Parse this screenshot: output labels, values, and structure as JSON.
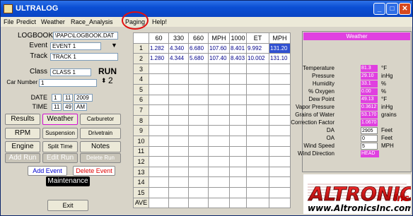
{
  "window": {
    "title": "ULTRALOG"
  },
  "menu": [
    "File",
    "Predict",
    "Weather",
    "Race_Analysis",
    "Paging",
    "Help!"
  ],
  "left": {
    "logbook_label": "LOGBOOK",
    "logbook_value": "\\PAPC\\LOGBOOK.DAT",
    "event_label": "Event",
    "event_value": "EVENT 1",
    "track_label": "Track",
    "track_value": "TRACK 1",
    "class_label": "Class",
    "class_value": "CLASS 1",
    "run_label": "RUN",
    "run_value": "2",
    "car_number_label": "Car Number",
    "car_number_value": "1",
    "date_label": "DATE",
    "date_m": "1",
    "date_d": "11",
    "date_y": "2009",
    "time_label": "TIME",
    "time_h": "11",
    "time_m": "49",
    "time_ampm": "AM",
    "buttons": {
      "results": "Results",
      "weather": "Weather",
      "carburetor": "Carburetor",
      "rpm": "RPM",
      "suspension": "Suspension",
      "drivetrain": "Drivetrain",
      "engine": "Engine",
      "split_time": "Split Time",
      "notes": "Notes",
      "add_run": "Add Run",
      "edit_run": "Edit Run",
      "delete_run": "Delete Run",
      "add_event": "Add Event",
      "delete_event": "Delete Event",
      "maintenance": "Maintenance",
      "exit": "Exit"
    }
  },
  "grid": {
    "headers": [
      "60",
      "330",
      "660",
      "MPH",
      "1000",
      "ET",
      "MPH"
    ],
    "rows": [
      {
        "n": "1",
        "cells": [
          "1.282",
          "4.340",
          "6.680",
          "107.60",
          "8.401",
          "9.992",
          "131.20"
        ]
      },
      {
        "n": "2",
        "cells": [
          "1.280",
          "4.344",
          "5.680",
          "107.40",
          "8.403",
          "10.002",
          "131.10"
        ]
      },
      {
        "n": "3",
        "cells": [
          "",
          "",
          "",
          "",
          "",
          "",
          ""
        ]
      },
      {
        "n": "4",
        "cells": [
          "",
          "",
          "",
          "",
          "",
          "",
          ""
        ]
      },
      {
        "n": "5",
        "cells": [
          "",
          "",
          "",
          "",
          "",
          "",
          ""
        ]
      },
      {
        "n": "6",
        "cells": [
          "",
          "",
          "",
          "",
          "",
          "",
          ""
        ]
      },
      {
        "n": "7",
        "cells": [
          "",
          "",
          "",
          "",
          "",
          "",
          ""
        ]
      },
      {
        "n": "8",
        "cells": [
          "",
          "",
          "",
          "",
          "",
          "",
          ""
        ]
      },
      {
        "n": "9",
        "cells": [
          "",
          "",
          "",
          "",
          "",
          "",
          ""
        ]
      },
      {
        "n": "10",
        "cells": [
          "",
          "",
          "",
          "",
          "",
          "",
          ""
        ]
      },
      {
        "n": "11",
        "cells": [
          "",
          "",
          "",
          "",
          "",
          "",
          ""
        ]
      },
      {
        "n": "12",
        "cells": [
          "",
          "",
          "",
          "",
          "",
          "",
          ""
        ]
      },
      {
        "n": "13",
        "cells": [
          "",
          "",
          "",
          "",
          "",
          "",
          ""
        ]
      },
      {
        "n": "14",
        "cells": [
          "",
          "",
          "",
          "",
          "",
          "",
          ""
        ]
      },
      {
        "n": "15",
        "cells": [
          "",
          "",
          "",
          "",
          "",
          "",
          ""
        ]
      },
      {
        "n": "AVE",
        "cells": [
          "",
          "",
          "",
          "",
          "",
          "",
          ""
        ]
      }
    ]
  },
  "weather": {
    "title": "Weather",
    "rows": [
      {
        "label": "Temperature",
        "value": "81.3",
        "unit": "°F"
      },
      {
        "label": "Pressure",
        "value": "29.10",
        "unit": "inHg"
      },
      {
        "label": "Humidity",
        "value": "33.1",
        "unit": "%"
      },
      {
        "label": "% Oxygen",
        "value": "0.00",
        "unit": "%"
      },
      {
        "label": "Dew Point",
        "value": "49.13",
        "unit": "°F"
      },
      {
        "label": "Vapor Pressure",
        "value": "0.3612",
        "unit": "inHg"
      },
      {
        "label": "Grains of Water",
        "value": "53.170",
        "unit": "grains"
      },
      {
        "label": "Correction Factor",
        "value": "1.0670",
        "unit": ""
      },
      {
        "label": "DA",
        "value": "2905",
        "unit": "Feet"
      },
      {
        "label": "OA",
        "value": "0",
        "unit": "Feet"
      },
      {
        "label": "Wind Speed",
        "value": "5",
        "unit": "MPH"
      },
      {
        "label": "Wind Direction",
        "value": "HEAD",
        "unit": ""
      }
    ]
  },
  "logo": {
    "brand": "ALTRONICS",
    "suffix": "inc",
    "url": "www.AltronicsInc.com"
  }
}
